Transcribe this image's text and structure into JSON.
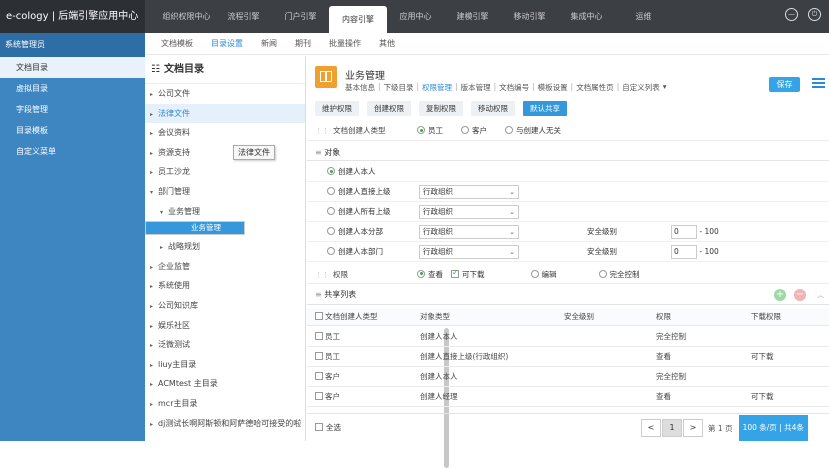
{
  "brand": "e-cology | 后端引擎应用中心",
  "topnav": [
    "组织权限中心",
    "流程引擎",
    "门户引擎",
    "内容引擎",
    "应用中心",
    "建模引擎",
    "移动引擎",
    "集成中心",
    "运维"
  ],
  "sidebar": {
    "head": "系统管理员",
    "items": [
      "文档目录",
      "虚拟目录",
      "字段管理",
      "目录模板",
      "自定义菜单"
    ]
  },
  "subnav": [
    "文档模板",
    "目录设置",
    "新闻",
    "期刊",
    "批量操作",
    "其他"
  ],
  "tree": {
    "title": "文档目录",
    "tooltip": "法律文件",
    "items": [
      {
        "label": "公司文件",
        "level": 0,
        "arrow": "▸"
      },
      {
        "label": "法律文件",
        "level": 0,
        "arrow": "▸"
      },
      {
        "label": "会议资料",
        "level": 0,
        "arrow": "▸"
      },
      {
        "label": "资源支持",
        "level": 0,
        "arrow": "▸"
      },
      {
        "label": "员工沙龙",
        "level": 0,
        "arrow": "▸"
      },
      {
        "label": "部门管理",
        "level": 0,
        "arrow": "▾"
      },
      {
        "label": "业务管理",
        "level": 1,
        "arrow": "▾"
      },
      {
        "label": "业务管理",
        "level": 2,
        "arrow": ""
      },
      {
        "label": "战略规划",
        "level": 1,
        "arrow": "▸"
      },
      {
        "label": "企业监管",
        "level": 0,
        "arrow": "▸"
      },
      {
        "label": "系统使用",
        "level": 0,
        "arrow": "▸"
      },
      {
        "label": "公司知识库",
        "level": 0,
        "arrow": "▸"
      },
      {
        "label": "娱乐社区",
        "level": 0,
        "arrow": "▸"
      },
      {
        "label": "泛微测试",
        "level": 0,
        "arrow": "▸"
      },
      {
        "label": "liuy主目录",
        "level": 0,
        "arrow": "▸"
      },
      {
        "label": "ACMtest 主目录",
        "level": 0,
        "arrow": "▸"
      },
      {
        "label": "mcr主目录",
        "level": 0,
        "arrow": "▸"
      },
      {
        "label": "dj测试长啊阿斯顿和阿萨德哈可接受的啦",
        "level": 0,
        "arrow": "▸"
      }
    ]
  },
  "main": {
    "title": "业务管理",
    "tabs": [
      "基本信息",
      "下级目录",
      "权限管理",
      "版本管理",
      "文档编号",
      "模板设置",
      "文档属性页",
      "自定义列表"
    ],
    "save": "保存",
    "btabs": [
      "维护权限",
      "创建权限",
      "复制权限",
      "移动权限",
      "默认共享"
    ],
    "creator_type": {
      "label": "文档创建人类型",
      "options": [
        "员工",
        "客户",
        "与创建人无关"
      ]
    },
    "object_section": "对象",
    "objects": [
      {
        "label": "创建人本人",
        "select": "",
        "security": "",
        "min": "",
        "max": ""
      },
      {
        "label": "创建人直接上级",
        "select": "行政组织",
        "security": "",
        "min": "",
        "max": ""
      },
      {
        "label": "创建人所有上级",
        "select": "行政组织",
        "security": "",
        "min": "",
        "max": ""
      },
      {
        "label": "创建人本分部",
        "select": "行政组织",
        "security": "安全级别",
        "min": "0",
        "max": "100"
      },
      {
        "label": "创建人本部门",
        "select": "行政组织",
        "security": "安全级别",
        "min": "0",
        "max": "100"
      }
    ],
    "perm": {
      "label": "权限",
      "view": "查看",
      "download": "可下载",
      "edit": "编辑",
      "full": "完全控制"
    },
    "share_section": "共享列表",
    "table_headers": [
      "文档创建人类型",
      "对象类型",
      "安全级别",
      "权限",
      "下载权限"
    ],
    "rows": [
      [
        "员工",
        "创建人本人",
        "",
        "完全控制",
        ""
      ],
      [
        "员工",
        "创建人直接上级(行政组织)",
        "",
        "查看",
        "可下载"
      ],
      [
        "客户",
        "创建人本人",
        "",
        "完全控制",
        ""
      ],
      [
        "客户",
        "创建人经理",
        "",
        "查看",
        "可下载"
      ]
    ],
    "select_all": "全选",
    "pager": {
      "prev": "<",
      "page": "1",
      "next": ">",
      "label_page": "第",
      "input": "1",
      "label_total": "页",
      "size": "100 条/页 | 共4条"
    }
  }
}
